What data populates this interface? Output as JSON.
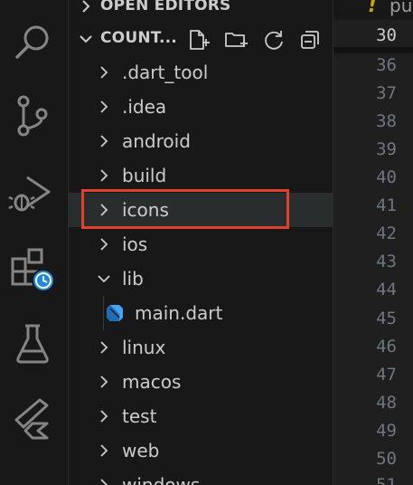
{
  "explorer": {
    "open_editors_label": "OPEN EDITORS",
    "folder_label": "COUNT...",
    "actions": [
      {
        "icon": "new-file-icon"
      },
      {
        "icon": "new-folder-icon"
      },
      {
        "icon": "refresh-icon"
      },
      {
        "icon": "collapse-all-icon"
      }
    ],
    "items": [
      {
        "label": ".dart_tool",
        "type": "folder",
        "expanded": false
      },
      {
        "label": ".idea",
        "type": "folder",
        "expanded": false
      },
      {
        "label": "android",
        "type": "folder",
        "expanded": false
      },
      {
        "label": "build",
        "type": "folder",
        "expanded": false
      },
      {
        "label": "icons",
        "type": "folder",
        "expanded": false,
        "selected": true
      },
      {
        "label": "ios",
        "type": "folder",
        "expanded": false
      },
      {
        "label": "lib",
        "type": "folder",
        "expanded": true
      },
      {
        "label": "main.dart",
        "type": "file",
        "depth": 1
      },
      {
        "label": "linux",
        "type": "folder",
        "expanded": false
      },
      {
        "label": "macos",
        "type": "folder",
        "expanded": false
      },
      {
        "label": "test",
        "type": "folder",
        "expanded": false
      },
      {
        "label": "web",
        "type": "folder",
        "expanded": false
      },
      {
        "label": "windows",
        "type": "folder",
        "expanded": false
      }
    ]
  },
  "activity_bar": [
    {
      "icon": "search-icon"
    },
    {
      "icon": "source-control-icon"
    },
    {
      "icon": "run-debug-icon"
    },
    {
      "icon": "extensions-clock-icon"
    },
    {
      "icon": "testing-flask-icon"
    },
    {
      "icon": "flutter-icon"
    }
  ],
  "editor": {
    "tab_warning": "!",
    "tab_text": "pu",
    "sticky_line": "30",
    "line_numbers": [
      "36",
      "37",
      "38",
      "39",
      "40",
      "41",
      "42",
      "43",
      "44",
      "45",
      "46",
      "47",
      "48",
      "49",
      "50",
      "51"
    ]
  },
  "colors": {
    "highlight": "#e0412c",
    "warning": "#cca700",
    "text": "#cccccc",
    "dart_blue": "#42a5f5"
  }
}
